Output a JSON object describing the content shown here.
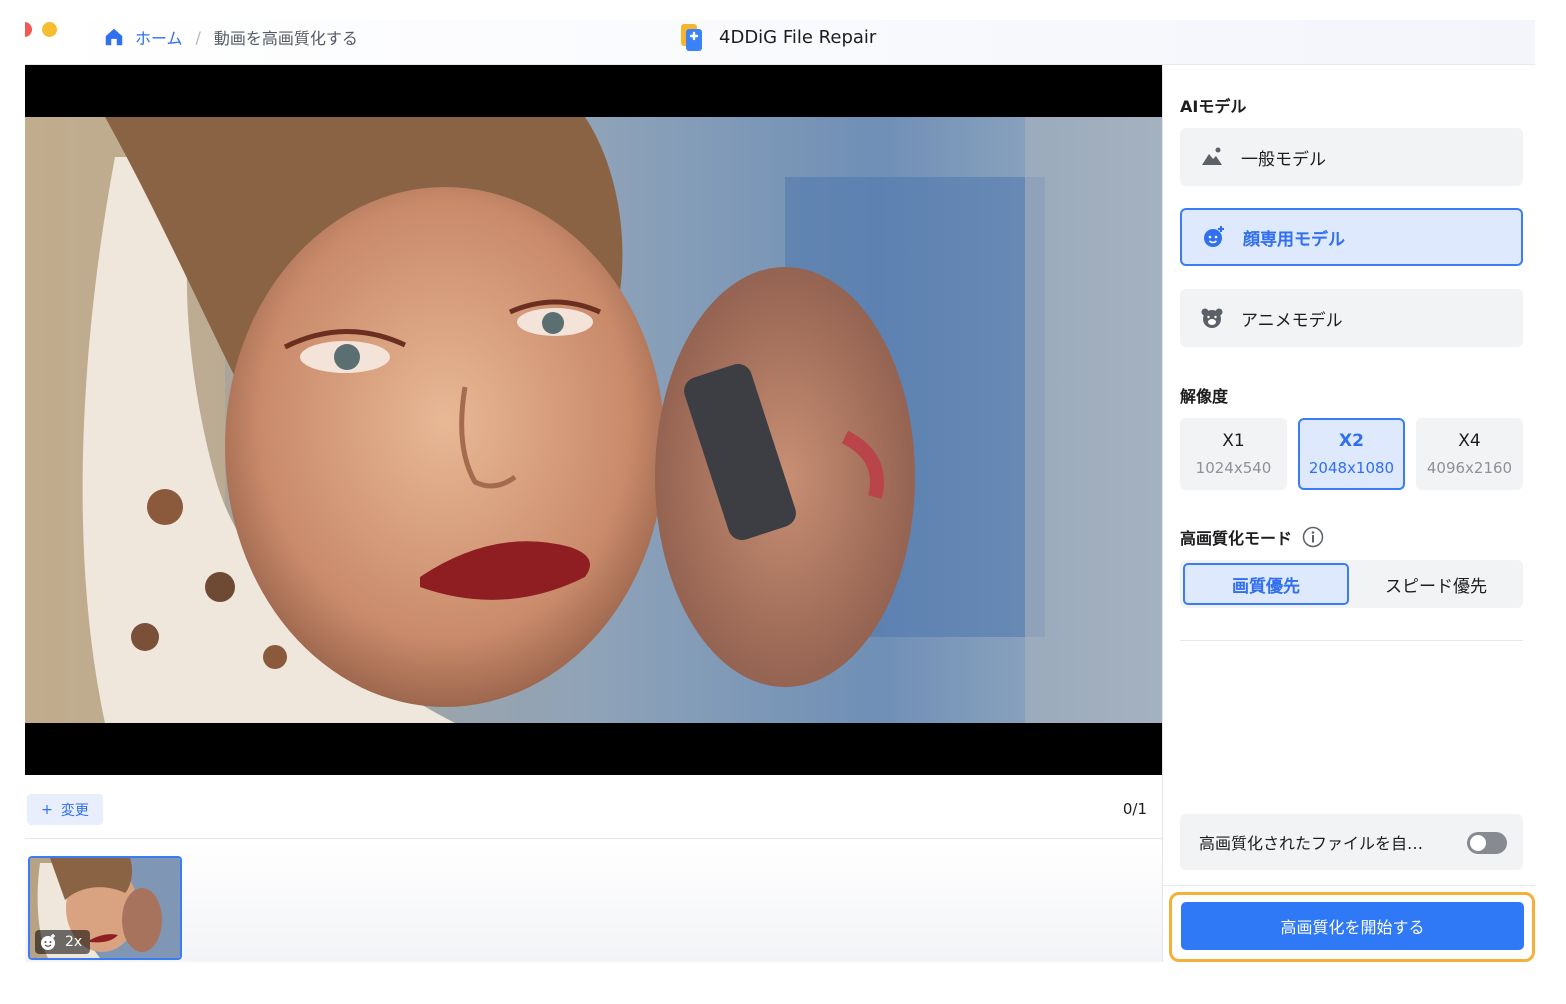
{
  "window": {
    "app_title": "4DDiG File Repair",
    "breadcrumb": {
      "home": "ホーム",
      "separator": "/",
      "current": "動画を高画質化する"
    }
  },
  "toolbar": {
    "change_label": "変更",
    "change_icon": "plus-icon",
    "page_counter": "0/1"
  },
  "thumbnail": {
    "badge": "2x",
    "badge_icon": "face-icon"
  },
  "panel": {
    "ai_model_title": "AIモデル",
    "models": [
      {
        "label": "一般モデル",
        "icon": "landscape-icon",
        "selected": false
      },
      {
        "label": "顔専用モデル",
        "icon": "face-icon",
        "selected": true
      },
      {
        "label": "アニメモデル",
        "icon": "bear-icon",
        "selected": false
      }
    ],
    "resolution_title": "解像度",
    "resolutions": [
      {
        "label": "X1",
        "size": "1024x540",
        "selected": false
      },
      {
        "label": "X2",
        "size": "2048x1080",
        "selected": true
      },
      {
        "label": "X4",
        "size": "4096x2160",
        "selected": false
      }
    ],
    "mode_title": "高画質化モード",
    "mode_info_icon": "info-icon",
    "modes": [
      {
        "label": "画質優先",
        "selected": true
      },
      {
        "label": "スピード優先",
        "selected": false
      }
    ],
    "autosave_label": "高画質化されたファイルを自…",
    "autosave_enabled": false,
    "start_label": "高画質化を開始する"
  },
  "colors": {
    "accent": "#2f78f6",
    "highlight_border": "#f4b13a",
    "selected_bg": "#dfe9fd"
  }
}
